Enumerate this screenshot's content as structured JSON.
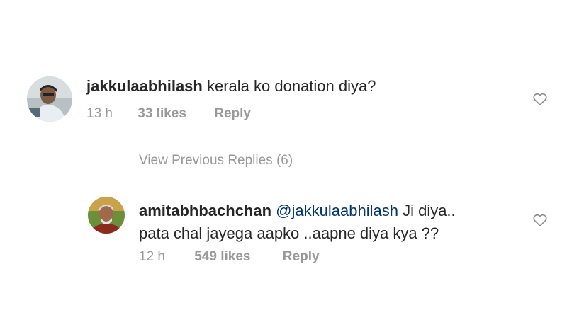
{
  "comments": [
    {
      "username": "jakkulaabhilash",
      "text": "kerala ko donation diya?",
      "time": "13 h",
      "likes": "33 likes",
      "reply_label": "Reply",
      "avatar_icon": "profile-photo-man"
    },
    {
      "username": "amitabhbachchan",
      "mention": "@jakkulaabhilash",
      "text_line1": "Ji diya..",
      "text_line2": "pata chal jayega aapko ..aapne diya kya ??",
      "time": "12 h",
      "likes": "549 likes",
      "reply_label": "Reply",
      "avatar_icon": "profile-photo-amitabh"
    }
  ],
  "view_previous": "View Previous Replies (6)",
  "like_icon": "heart-outline-icon",
  "colors": {
    "text": "#262626",
    "meta": "#999999",
    "mention": "#003569",
    "divider": "#c7c7c7"
  }
}
